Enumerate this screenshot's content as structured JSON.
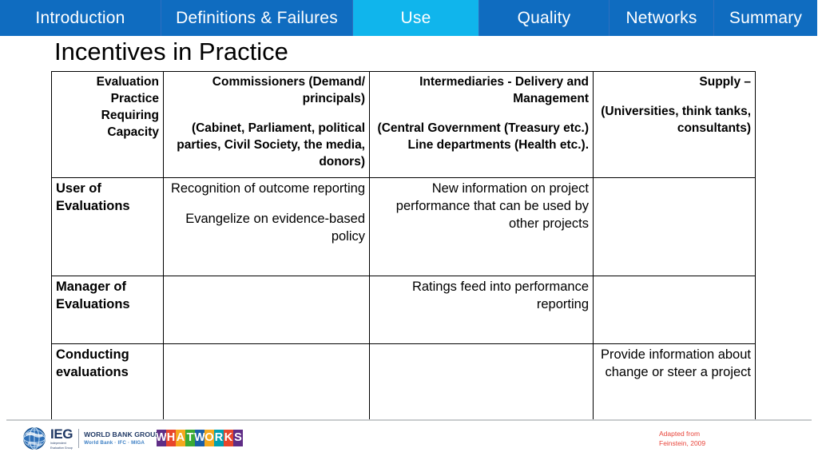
{
  "nav": {
    "tabs": [
      {
        "label": "Introduction",
        "active": false
      },
      {
        "label": "Definitions & Failures",
        "active": false
      },
      {
        "label": "Use",
        "active": true
      },
      {
        "label": "Quality",
        "active": false
      },
      {
        "label": "Networks",
        "active": false
      },
      {
        "label": "Summary",
        "active": false
      }
    ],
    "active_color": "#10b5ec",
    "inactive_color": "#0f6cc0"
  },
  "slide": {
    "title": "Incentives in Practice"
  },
  "table": {
    "headers": {
      "col_a": "Evaluation Practice Requiring Capacity",
      "col_b_line1": "Commissioners  (Demand/ principals)",
      "col_b_line2": "(Cabinet, Parliament, political parties, Civil Society, the media, donors)",
      "col_c_line1": "Intermediaries - Delivery and Management",
      "col_c_line2": "(Central Government (Treasury etc.) Line departments (Health etc.).",
      "col_d_line1": "Supply –",
      "col_d_line2": "(Universities, think tanks, consultants)"
    },
    "rows": [
      {
        "label": "User of Evaluations",
        "commissioners_1": "Recognition of outcome reporting",
        "commissioners_2": "Evangelize on evidence-based policy",
        "intermediaries": "New information on project performance that can be used by other projects",
        "supply": ""
      },
      {
        "label": "Manager of Evaluations",
        "commissioners_1": "",
        "commissioners_2": "",
        "intermediaries": "Ratings feed into performance reporting",
        "supply": ""
      },
      {
        "label": "Conducting evaluations",
        "commissioners_1": "",
        "commissioners_2": "",
        "intermediaries": "",
        "supply": "Provide information about change or steer a project"
      }
    ]
  },
  "footer": {
    "ieg": {
      "acronym": "IEG",
      "sub_line1": "Independent",
      "sub_line2": "Evaluation Group",
      "wbg_main": "WORLD BANK GROUP",
      "wbg_sub": "World Bank · IFC · MIGA"
    },
    "whatworks": {
      "letters": [
        {
          "char": "W",
          "bg": "#5f2d86"
        },
        {
          "char": "H",
          "bg": "#e8462c"
        },
        {
          "char": "A",
          "bg": "#f4a81d"
        },
        {
          "char": "T",
          "bg": "#3aaa35"
        },
        {
          "char": "W",
          "bg": "#1a5fa8"
        },
        {
          "char": "O",
          "bg": "#f4a81d"
        },
        {
          "char": "R",
          "bg": "#00a0b0"
        },
        {
          "char": "K",
          "bg": "#e8462c"
        },
        {
          "char": "S",
          "bg": "#5f2d86"
        }
      ]
    },
    "credit_line1": "Adapted from",
    "credit_line2": "Feinstein, 2009",
    "credit_color": "#e8443a"
  }
}
